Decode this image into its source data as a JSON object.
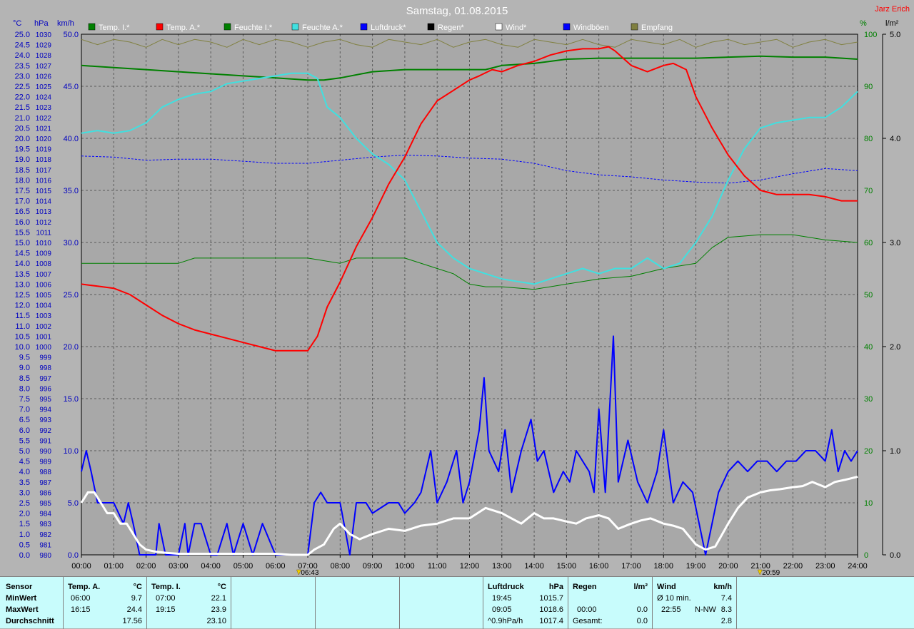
{
  "header": {
    "title": "Samstag, 01.08.2015",
    "author": "Jarz Erich"
  },
  "axis_units": {
    "temp": "°C",
    "pressure": "hPa",
    "wind": "km/h",
    "humidity": "%",
    "rain": "l/m²"
  },
  "legend": [
    {
      "label": "Temp. I.*",
      "color": "#008000"
    },
    {
      "label": "Temp. A.*",
      "color": "#ff0000"
    },
    {
      "label": "Feuchte I.*",
      "color": "#008000"
    },
    {
      "label": "Feuchte A.*",
      "color": "#40e0e0"
    },
    {
      "label": "Luftdruck*",
      "color": "#0000ff"
    },
    {
      "label": "Regen*",
      "color": "#000000"
    },
    {
      "label": "Wind*",
      "color": "#ffffff"
    },
    {
      "label": "Windböen",
      "color": "#0000ff"
    },
    {
      "label": "Empfang",
      "color": "#808040"
    }
  ],
  "markers": [
    {
      "label": "06:43",
      "hour": 6.72
    },
    {
      "label": "20:59",
      "hour": 20.98
    }
  ],
  "chart_data": {
    "type": "line",
    "title": "Samstag, 01.08.2015",
    "xlim": [
      0,
      24
    ],
    "x_tick_labels": [
      "00:00",
      "01:00",
      "02:00",
      "03:00",
      "04:00",
      "05:00",
      "06:00",
      "07:00",
      "08:00",
      "09:00",
      "10:00",
      "11:00",
      "12:00",
      "13:00",
      "14:00",
      "15:00",
      "16:00",
      "17:00",
      "18:00",
      "19:00",
      "20:00",
      "21:00",
      "22:00",
      "23:00",
      "24:00"
    ],
    "temp_axis": {
      "unit": "°C",
      "ylim": [
        0,
        25
      ],
      "ticks": [
        "0.0",
        "0.5",
        "1.0",
        "1.5",
        "2.0",
        "2.5",
        "3.0",
        "3.5",
        "4.0",
        "4.5",
        "5.0",
        "5.5",
        "6.0",
        "6.5",
        "7.0",
        "7.5",
        "8.0",
        "8.5",
        "9.0",
        "9.5",
        "10.0",
        "10.5",
        "11.0",
        "11.5",
        "12.0",
        "12.5",
        "13.0",
        "13.5",
        "14.0",
        "14.5",
        "15.0",
        "15.5",
        "16.0",
        "16.5",
        "17.0",
        "17.5",
        "18.0",
        "18.5",
        "19.0",
        "19.5",
        "20.0",
        "20.5",
        "21.0",
        "21.5",
        "22.0",
        "22.5",
        "23.0",
        "23.5",
        "24.0",
        "24.5",
        "25.0"
      ]
    },
    "pressure_axis": {
      "unit": "hPa",
      "ylim": [
        980,
        1030
      ]
    },
    "wind_axis": {
      "unit": "km/h",
      "ylim": [
        0,
        50
      ],
      "ticks": [
        "0.0",
        "5.0",
        "10.0",
        "15.0",
        "20.0",
        "25.0",
        "30.0",
        "35.0",
        "40.0",
        "45.0",
        "50.0"
      ]
    },
    "humidity_axis": {
      "unit": "%",
      "ylim": [
        0,
        100
      ],
      "ticks": [
        "0",
        "10",
        "20",
        "30",
        "40",
        "50",
        "60",
        "70",
        "80",
        "90",
        "100"
      ]
    },
    "rain_axis": {
      "unit": "l/m²",
      "ylim": [
        0,
        5
      ],
      "ticks": [
        "0.0",
        "1.0",
        "2.0",
        "3.0",
        "4.0",
        "5.0"
      ]
    },
    "series": [
      {
        "name": "Temp. A.*",
        "axis": "temp",
        "color": "#ff0000",
        "width": 2,
        "x": [
          0,
          0.5,
          1,
          1.5,
          2,
          2.5,
          3,
          3.5,
          4,
          4.5,
          5,
          5.5,
          6,
          6.5,
          7,
          7.3,
          7.6,
          8,
          8.5,
          9,
          9.5,
          10,
          10.5,
          11,
          11.5,
          12,
          12.3,
          12.7,
          13,
          13.5,
          14,
          14.5,
          15,
          15.5,
          16,
          16.3,
          16.5,
          17,
          17.5,
          18,
          18.3,
          18.7,
          19,
          19.5,
          20,
          20.5,
          21,
          21.5,
          22,
          22.5,
          23,
          23.5,
          24
        ],
        "y": [
          13.0,
          12.9,
          12.8,
          12.5,
          12.0,
          11.5,
          11.1,
          10.8,
          10.6,
          10.4,
          10.2,
          10.0,
          9.8,
          9.8,
          9.8,
          10.5,
          11.9,
          13.1,
          14.8,
          16.2,
          17.8,
          19.1,
          20.7,
          21.8,
          22.3,
          22.8,
          23.0,
          23.3,
          23.2,
          23.5,
          23.7,
          24.0,
          24.2,
          24.3,
          24.3,
          24.4,
          24.2,
          23.5,
          23.2,
          23.5,
          23.6,
          23.3,
          22.0,
          20.5,
          19.2,
          18.2,
          17.5,
          17.3,
          17.3,
          17.3,
          17.2,
          17.0,
          17.0
        ]
      },
      {
        "name": "Temp. I.*",
        "axis": "temp",
        "color": "#008000",
        "width": 2,
        "x": [
          0,
          1,
          2,
          3,
          4,
          5,
          6,
          7,
          7.5,
          8,
          9,
          10,
          11,
          12,
          12.5,
          13,
          14,
          15,
          16,
          17,
          18,
          19,
          20,
          21,
          22,
          23,
          24
        ],
        "y": [
          23.5,
          23.4,
          23.3,
          23.2,
          23.1,
          23.0,
          22.9,
          22.8,
          22.8,
          22.9,
          23.2,
          23.3,
          23.3,
          23.3,
          23.3,
          23.5,
          23.6,
          23.8,
          23.85,
          23.85,
          23.85,
          23.85,
          23.9,
          23.95,
          23.9,
          23.9,
          23.8
        ]
      },
      {
        "name": "Feuchte I.*",
        "axis": "humidity",
        "color": "#008000",
        "width": 1,
        "x": [
          0,
          1,
          2,
          3,
          3.5,
          4,
          5,
          6,
          7,
          8,
          8.5,
          9,
          10,
          11,
          11.5,
          12,
          12.5,
          13,
          14,
          15,
          16,
          17,
          18,
          19,
          19.5,
          20,
          21,
          22,
          23,
          24
        ],
        "y": [
          56,
          56,
          56,
          56,
          57,
          57,
          57,
          57,
          57,
          56,
          57,
          57,
          57,
          55,
          54,
          52,
          51.5,
          51.5,
          51,
          52,
          53,
          53.5,
          55,
          56,
          59,
          61,
          61.5,
          61.5,
          60.5,
          60
        ]
      },
      {
        "name": "Feuchte A.*",
        "axis": "humidity",
        "color": "#40e0e0",
        "width": 2,
        "x": [
          0,
          0.5,
          1,
          1.5,
          2,
          2.5,
          3,
          3.5,
          4,
          4.5,
          5,
          5.5,
          6,
          6.5,
          7,
          7.3,
          7.6,
          8,
          8.5,
          9,
          9.5,
          10,
          10.5,
          11,
          11.5,
          12,
          12.5,
          13,
          13.5,
          14,
          14.5,
          15,
          15.5,
          16,
          16.5,
          17,
          17.5,
          18,
          18.5,
          19,
          19.5,
          20,
          20.5,
          21,
          21.5,
          22,
          22.5,
          23,
          23.5,
          24
        ],
        "y": [
          81,
          81.5,
          81,
          81.5,
          83,
          86,
          87.5,
          88.5,
          89,
          90.5,
          91,
          91.5,
          92,
          92.5,
          92.5,
          91.5,
          86,
          84,
          80,
          77,
          75,
          72,
          66,
          60,
          57,
          55,
          54,
          53,
          52.5,
          52,
          53,
          54,
          55,
          54,
          55,
          55,
          57,
          55,
          56,
          60,
          65,
          72,
          78,
          82,
          83,
          83.5,
          84,
          84,
          86,
          89
        ]
      },
      {
        "name": "Luftdruck*",
        "axis": "pressure",
        "color": "#0000ff",
        "width": 1,
        "dash": "3,2",
        "x": [
          0,
          1,
          2,
          3,
          4,
          5,
          6,
          7,
          8,
          9,
          10,
          11,
          12,
          13,
          14,
          15,
          16,
          17,
          18,
          19,
          20,
          21,
          22,
          23,
          24
        ],
        "y": [
          1018.3,
          1018.2,
          1017.9,
          1018.0,
          1018.0,
          1017.8,
          1017.6,
          1017.6,
          1017.9,
          1018.2,
          1018.4,
          1018.3,
          1018.1,
          1018.0,
          1017.6,
          1016.9,
          1016.5,
          1016.3,
          1016.0,
          1015.8,
          1015.7,
          1016.0,
          1016.6,
          1017.1,
          1016.9
        ]
      },
      {
        "name": "Windböen",
        "axis": "wind",
        "color": "#0000ff",
        "width": 2,
        "x": [
          0,
          0.15,
          0.3,
          0.5,
          1,
          1.3,
          1.45,
          1.6,
          1.8,
          2,
          2.3,
          2.4,
          2.6,
          3.0,
          3.2,
          3.3,
          3.5,
          3.7,
          4.0,
          4.2,
          4.5,
          4.7,
          5.0,
          5.3,
          5.6,
          6.0,
          6.5,
          7.0,
          7.2,
          7.4,
          7.6,
          8.0,
          8.3,
          8.5,
          8.8,
          9.0,
          9.5,
          9.8,
          10,
          10.3,
          10.5,
          10.8,
          11,
          11.3,
          11.6,
          11.8,
          12,
          12.3,
          12.45,
          12.6,
          12.9,
          13.1,
          13.3,
          13.6,
          13.9,
          14.1,
          14.3,
          14.6,
          14.9,
          15.1,
          15.3,
          15.5,
          15.7,
          15.85,
          16.0,
          16.2,
          16.45,
          16.6,
          16.9,
          17.2,
          17.5,
          17.8,
          18.0,
          18.3,
          18.6,
          18.9,
          19.1,
          19.3,
          19.5,
          19.7,
          20,
          20.3,
          20.6,
          20.9,
          21.2,
          21.5,
          21.8,
          22.1,
          22.4,
          22.7,
          23,
          23.2,
          23.4,
          23.6,
          23.8,
          24
        ],
        "y": [
          8,
          10,
          8,
          5,
          5,
          3,
          5,
          3,
          0,
          0,
          0,
          3,
          0,
          0,
          3,
          0,
          3,
          3,
          0,
          0,
          3,
          0,
          3,
          0,
          3,
          0,
          0,
          0,
          5,
          6,
          5,
          5,
          0,
          5,
          5,
          4,
          5,
          5,
          4,
          5,
          6,
          10,
          5,
          7,
          10,
          5,
          7,
          12,
          17,
          10,
          8,
          12,
          6,
          10,
          13,
          9,
          10,
          6,
          8,
          7,
          10,
          9,
          8,
          6,
          14,
          6,
          21,
          7,
          11,
          7,
          5,
          8,
          12,
          5,
          7,
          6,
          3,
          0,
          3,
          6,
          8,
          9,
          8,
          9,
          9,
          8,
          9,
          9,
          10,
          10,
          9,
          12,
          8,
          10,
          9,
          10
        ]
      },
      {
        "name": "Wind*",
        "axis": "wind",
        "color": "#ffffff",
        "width": 3,
        "x": [
          0,
          0.2,
          0.4,
          0.6,
          0.8,
          1,
          1.2,
          1.4,
          1.6,
          1.8,
          2,
          2.3,
          2.6,
          3,
          3.5,
          4,
          5,
          6,
          6.5,
          7,
          7.2,
          7.5,
          7.8,
          8,
          8.3,
          8.6,
          9,
          9.5,
          10,
          10.5,
          11,
          11.5,
          12,
          12.5,
          13,
          13.3,
          13.6,
          14,
          14.3,
          14.6,
          15,
          15.3,
          15.6,
          16,
          16.3,
          16.6,
          17,
          17.3,
          17.6,
          18,
          18.3,
          18.6,
          19,
          19.3,
          19.6,
          20,
          20.3,
          20.6,
          21,
          21.3,
          21.6,
          22,
          22.3,
          22.6,
          23,
          23.3,
          23.6,
          24
        ],
        "y": [
          5,
          6,
          6,
          5,
          4,
          4,
          3,
          3,
          2,
          1,
          0.5,
          0.3,
          0.2,
          0.1,
          0.1,
          0.1,
          0.1,
          0.1,
          0,
          0,
          0.5,
          1,
          2.5,
          3,
          2,
          1.5,
          2,
          2.5,
          2.3,
          2.8,
          3,
          3.5,
          3.5,
          4.5,
          4,
          3.5,
          3,
          4,
          3.5,
          3.5,
          3.2,
          3,
          3.5,
          3.8,
          3.5,
          2.5,
          3,
          3.3,
          3.5,
          3,
          2.8,
          2.5,
          1,
          0.5,
          0.8,
          3,
          4.5,
          5.5,
          6,
          6.2,
          6.3,
          6.5,
          6.6,
          7,
          6.5,
          7,
          7.2,
          7.5
        ]
      },
      {
        "name": "Empfang",
        "axis": "humidity",
        "color": "#808040",
        "width": 1,
        "x": [
          0,
          0.5,
          1,
          1.5,
          2,
          2.5,
          3,
          3.5,
          4,
          4.5,
          5,
          5.5,
          6,
          6.5,
          7,
          7.5,
          8,
          8.5,
          9,
          9.5,
          10,
          10.5,
          11,
          11.5,
          12,
          12.5,
          13,
          13.5,
          14,
          14.5,
          15,
          15.5,
          16,
          16.5,
          17,
          17.5,
          18,
          18.5,
          19,
          19.5,
          20,
          20.5,
          21,
          21.5,
          22,
          22.5,
          23,
          23.5,
          24
        ],
        "y": [
          99,
          98,
          99,
          98.5,
          97.5,
          99,
          98,
          99,
          98.5,
          97.5,
          99,
          98,
          99,
          98.5,
          97.5,
          98.5,
          99,
          98,
          97.5,
          99,
          98.5,
          98,
          99,
          97.5,
          98.5,
          99,
          98,
          97.5,
          99,
          98.5,
          98,
          99,
          98,
          97.5,
          99,
          98.5,
          98,
          99,
          97.5,
          98.5,
          99,
          98,
          98.5,
          99,
          97.5,
          98.5,
          99,
          98,
          98.5
        ]
      }
    ]
  },
  "stats": {
    "sensor": {
      "header": "Sensor",
      "rows": [
        "MinWert",
        "MaxWert",
        "Durchschnitt"
      ]
    },
    "temp_a": {
      "header": "Temp. A.",
      "unit": "°C",
      "min_time": "06:00",
      "min": "9.7",
      "max_time": "16:15",
      "max": "24.4",
      "avg": "17.56"
    },
    "temp_i": {
      "header": "Temp. I.",
      "unit": "°C",
      "min_time": "07:00",
      "min": "22.1",
      "max_time": "19:15",
      "max": "23.9",
      "avg": "23.10"
    },
    "pressure": {
      "header": "Luftdruck",
      "unit": "hPa",
      "min_time": "19:45",
      "min": "1015.7",
      "max_time": "09:05",
      "max": "1018.6",
      "avg_label": "^0.9hPa/h",
      "avg": "1017.4"
    },
    "rain": {
      "header": "Regen",
      "unit": "l/m²",
      "row2_time": "00:00",
      "row2_val": "0.0",
      "row3_label": "Gesamt:",
      "row3_val": "0.0"
    },
    "wind": {
      "header": "Wind",
      "unit": "km/h",
      "row1_label": "Ø 10 min.",
      "row1_val": "7.4",
      "row2_time": "22:55",
      "row2_dir": "N-NW",
      "row2_val": "8.3",
      "row3_val": "2.8"
    }
  }
}
